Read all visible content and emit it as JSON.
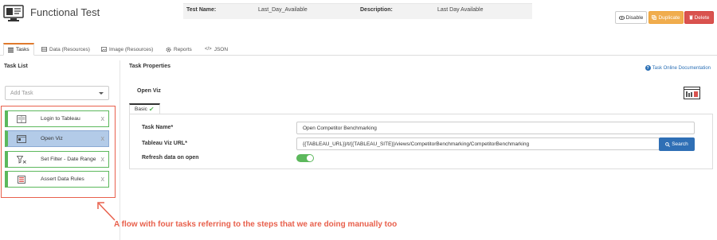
{
  "header": {
    "app_title": "Functional Test",
    "app_icon": "monitor-test-icon",
    "meta": {
      "test_name_label": "Test Name:",
      "test_name_value": "Last_Day_Available",
      "description_label": "Description:",
      "description_value": "Last Day Available"
    },
    "buttons": {
      "disable_label": "Disable",
      "duplicate_label": "Duplicate",
      "delete_label": "Delete"
    }
  },
  "tabs": [
    {
      "label": "Tasks",
      "icon": "list-icon",
      "active": true
    },
    {
      "label": "Data (Resources)",
      "icon": "table-icon",
      "active": false
    },
    {
      "label": "Image (Resources)",
      "icon": "image-icon",
      "active": false
    },
    {
      "label": "Reports",
      "icon": "gear-icon",
      "active": false
    },
    {
      "label": "JSON",
      "icon": "code-icon",
      "active": false
    }
  ],
  "task_list": {
    "title": "Task List",
    "add_task_placeholder": "Add Task",
    "items": [
      {
        "label": "Login to Tableau",
        "icon": "login-icon",
        "selected": false
      },
      {
        "label": "Open Viz",
        "icon": "window-icon",
        "selected": true
      },
      {
        "label": "Set Filter - Date Range",
        "icon": "filter-icon",
        "selected": false
      },
      {
        "label": "Assert Data Rules",
        "icon": "checklist-icon",
        "selected": false
      }
    ],
    "close_glyph": "x"
  },
  "task_properties": {
    "title": "Task Properties",
    "doc_link": "Task Online Documentation",
    "task_title": "Open Viz",
    "basic_tab": "Basic",
    "fields": {
      "task_name_label": "Task Name*",
      "task_name_value": "Open Competitor Benchmarking",
      "viz_url_label": "Tableau Viz URL*",
      "viz_url_value": "{{TABLEAU_URL}}/t/{{TABLEAU_SITE}}/views/CompetitorBenchmarking/CompetitorBenchmarking",
      "search_label": "Search",
      "refresh_label": "Refresh data on open",
      "refresh_on": true
    }
  },
  "annotation": {
    "text": "A flow with four tasks referring to the steps that we are doing manually too"
  },
  "colors": {
    "accent_orange": "#e07a2d",
    "success_green": "#5cb85c",
    "duplicate": "#f0ad4e",
    "delete": "#d9534f",
    "primary_blue": "#2f6fb5",
    "selected_task": "#b3cbe8",
    "annotation_red": "#e8604c"
  }
}
